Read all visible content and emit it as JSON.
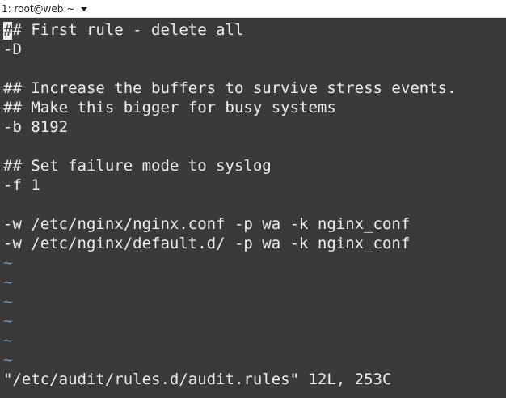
{
  "tab": {
    "title": "1: root@web:~",
    "menu_icon": "chevron-down-icon"
  },
  "terminal": {
    "cursor_char": "#",
    "lines": [
      "## First rule - delete all",
      "-D",
      "",
      "## Increase the buffers to survive stress events.",
      "## Make this bigger for busy systems",
      "-b 8192",
      "",
      "## Set failure mode to syslog",
      "-f 1",
      "",
      "-w /etc/nginx/nginx.conf -p wa -k nginx_conf",
      "-w /etc/nginx/default.d/ -p wa -k nginx_conf"
    ],
    "tildes": [
      "~",
      "~",
      "~",
      "~",
      "~",
      "~"
    ],
    "status": "\"/etc/audit/rules.d/audit.rules\" 12L, 253C"
  },
  "colors": {
    "background": "#3a3a3a",
    "text": "#eeeeec",
    "tilde": "#6b9bc5"
  }
}
